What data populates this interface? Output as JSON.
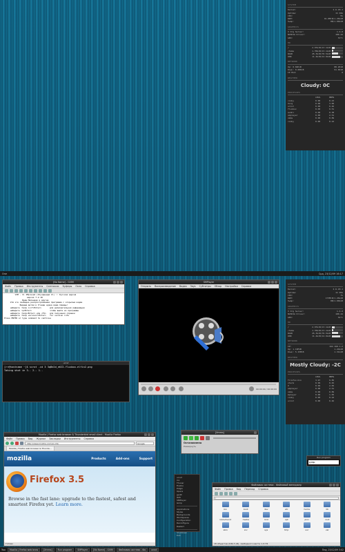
{
  "conky_top": {
    "system_header": "SYSTEM",
    "system_rows": [
      {
        "k": "Kernel:",
        "v": "2.6.29.1"
      },
      {
        "k": "Uptime:",
        "v": "1h 02m"
      },
      {
        "k": "CPU:",
        "v": "5%"
      },
      {
        "k": "RAM:",
        "v": "91.0MiB/1.26GiB"
      },
      {
        "k": "Swap:",
        "v": "0B/1.00GiB"
      }
    ],
    "graphics_header": "GRAPHICS",
    "graphics_rows": [
      {
        "k": "X Org Server:",
        "v": "1.6.0"
      },
      {
        "k": "NVIDIA Driver:",
        "v": "180.44"
      },
      {
        "k": "GPU:",
        "v": "53°C"
      }
    ],
    "hd_header": "HD",
    "hd_rows": [
      {
        "k": "/",
        "v": "2.97GiB/13.1GiB",
        "fill": 23
      },
      {
        "k": "/home",
        "v": "1.70GiB/13.1GiB",
        "fill": 13
      },
      {
        "k": "RAID",
        "v": "45.3GiB/78.5GiB",
        "fill": 58
      },
      {
        "k": "USB",
        "v": "11.4GiB/14.9GiB",
        "fill": 76
      }
    ],
    "network_header": "NETWORK",
    "network_rows": [
      {
        "k": "Up: 0.02KiB",
        "v": "88.2KiB"
      },
      {
        "k": "Down: 0.00KiB",
        "v": "91.6KiB"
      },
      {
        "k": "IP Mod:",
        "v": "0"
      }
    ],
    "weather_header": "WEATHER",
    "weather": "Cloudy: 0C",
    "processes_header": "PROCESSES",
    "proc_cols": [
      "",
      "CPU%",
      "MEM%"
    ],
    "processes": [
      [
        "conky",
        "0.00",
        "0.43"
      ],
      [
        "Xorg",
        "0.00",
        "3.06"
      ],
      [
        "urxvt",
        "0.00",
        "0.46"
      ],
      [
        "fluxbox",
        "0.00",
        "0.51"
      ],
      [
        "avahi",
        "0.00",
        "0.38"
      ],
      [
        "smplayer",
        "0.00",
        "2.51"
      ],
      [
        "xmms",
        "0.00",
        "0.89"
      ],
      [
        "conky",
        "0.00",
        "0.22"
      ]
    ]
  },
  "conky_bottom": {
    "system_header": "SYSTEM",
    "system_rows": [
      {
        "k": "Kernel:",
        "v": "2.6.29.1"
      },
      {
        "k": "Uptime:",
        "v": "1h 05m"
      },
      {
        "k": "CPU:",
        "v": "7%"
      },
      {
        "k": "RAM:",
        "v": "173MiB/1.26GiB"
      },
      {
        "k": "Swap:",
        "v": "0B/1.00GiB"
      }
    ],
    "graphics_header": "GRAPHICS",
    "graphics_rows": [
      {
        "k": "X Org Server:",
        "v": "1.6.0"
      },
      {
        "k": "NVIDIA Driver:",
        "v": "180.44"
      },
      {
        "k": "GPU:",
        "v": "54°C"
      }
    ],
    "hd_header": "HD",
    "hd_rows": [
      {
        "k": "/",
        "v": "2.97GiB/13.1GiB",
        "fill": 23
      },
      {
        "k": "/home",
        "v": "1.70GiB/13.1GiB",
        "fill": 13
      },
      {
        "k": "RAID",
        "v": "45.3GiB/78.5GiB",
        "fill": 58
      },
      {
        "k": "USB",
        "v": "11.4GiB/14.9GiB",
        "fill": 76
      }
    ],
    "network_header": "NETWORK",
    "network_rows": [
      {
        "k": "IP:",
        "v": "192.168.1.2"
      },
      {
        "k": "Up: 1.19MiB",
        "v": "1.24GiB"
      },
      {
        "k": "Down: 5.15MiB",
        "v": "1.31GiB"
      }
    ],
    "weather_header": "WEATHER",
    "weather": "Mostly Cloudy: -2C",
    "processes_header": "PROCESSES",
    "proc_cols": [
      "",
      "CPU%",
      "MEM%"
    ],
    "processes": [
      [
        "firefox-bin",
        "3.97",
        "9.85"
      ],
      [
        "xterm",
        "0.99",
        "0.45"
      ],
      [
        "X",
        "0.99",
        "2.65"
      ],
      [
        "smplayer",
        "0.00",
        "2.51"
      ],
      [
        "xmms",
        "0.00",
        "0.89"
      ],
      [
        "mplayer",
        "0.00",
        "1.05"
      ],
      [
        "conky",
        "0.00",
        "0.22"
      ],
      [
        "urxvt",
        "0.00",
        "0.46"
      ]
    ]
  },
  "topbar": {
    "left": "One",
    "right": "Срд, 23/12/09 16:17"
  },
  "gvim": {
    "title": "[No Name] - GVIM",
    "menu": [
      "Файл",
      "Правка",
      "Инструменты",
      "Синтаксис",
      "Буферы",
      "Окно",
      "Справка"
    ],
    "lines": [
      "         VIM - Vi IMproved (Улучшенный Vi) :: Русская версия",
      "",
      "                   версия 7.2.18",
      "               Брам Моленаар и другие",
      "     Vim это свободно распространяемая программа с открытым кодом",
      "",
      "             Бедным детям в Уганде нужна ваша помощь!",
      "     наберите :help iccf<Enter>       для дополнительной информации",
      "",
      "     наберите :q<Enter>               чтобы выйти из программы",
      "     наберите :help<Enter> или <F1>   для получения справки",
      "     наберите :help version7<Enter>   for version info",
      "Press ENTER or type command to continue"
    ]
  },
  "term": {
    "title": "urxvt",
    "lines": [
      "[rr@hostname ~]$ scrot -cd 3 3qBe2d_e6Z2-fluxbox-elfin2.png",
      "Taking shot in 3.. 2.. 1.."
    ]
  },
  "smplayer": {
    "title": "SMPlayer",
    "menu": [
      "Открыть",
      "Воспроизведение",
      "Видео",
      "Звук",
      "Субтитры",
      "Обзор",
      "Настройки",
      "Справка"
    ],
    "time": "00:00:00 / 00:00:00"
  },
  "firefox": {
    "title": "Mozilla | Firefox web browser & Thunderbird email client - Mozilla Firefox",
    "menu": [
      "Файл",
      "Правка",
      "Вид",
      "Журнал",
      "Закладки",
      "Инструменты",
      "Справка"
    ],
    "url": "http://www.mozilla.com/en-US/",
    "search_placeholder": "Google",
    "tab": "Mozilla | Firefox web browser & Thunde...",
    "logo": "mozilla",
    "nav": [
      "Products",
      "Add-ons",
      "Support"
    ],
    "brand": "Firefox 3.5",
    "desc": "Browse in the fast lane: upgrade to the fastest, safest and smartest Firefox yet.",
    "learn": "Learn more.",
    "status": "Готово"
  },
  "xmms": {
    "title": "[Xmms]",
    "status": "Остановлено",
    "sub": "Развернуть"
  },
  "runp": {
    "title": "Run program",
    "value": "gimp"
  },
  "fbmenu": {
    "top": [
      "urxvt",
      "mc",
      "Thunar",
      "Firefox",
      "Pidgin",
      "Opera",
      "gedit",
      "Wifi",
      "SMPlayer",
      "Gimp"
    ],
    "mid": [
      "Applications",
      "Styles",
      "Backgrounds",
      "Workspaces",
      "Configuration",
      "Reconfigure",
      "Restart"
    ],
    "bot": [
      "Shutdown",
      "Exit"
    ]
  },
  "filemgr": {
    "title": "Файловая система - Файловый менеджер",
    "menu": [
      "Файл",
      "Правка",
      "Вид",
      "Переход",
      "Справка"
    ],
    "path": "/",
    "items": [
      "bin",
      "boot",
      "dev",
      "etc",
      "home",
      "lib",
      "lost+found",
      "media",
      "mnt",
      "opt",
      "proc",
      "root",
      "sbin",
      "srv",
      "sys",
      "tmp",
      "usr",
      "var"
    ],
    "status": "18 объектов (106,3 кБ), свободного места: 1,5 ГБ"
  },
  "taskbar": {
    "workspace": "Two",
    "tasks": [
      "Mozilla | Firefox web brow",
      "[Xmms]",
      "Run program",
      "SMPlayer",
      "[No Name] - GVIM",
      "Файловая система - Фа",
      "urxvt"
    ],
    "clock": "Пнд, 23/12/09  3:02"
  },
  "colors": {
    "accent": "#14769a",
    "conky_bg": "#262626",
    "taskbar_bg": "#1a1a1a"
  }
}
